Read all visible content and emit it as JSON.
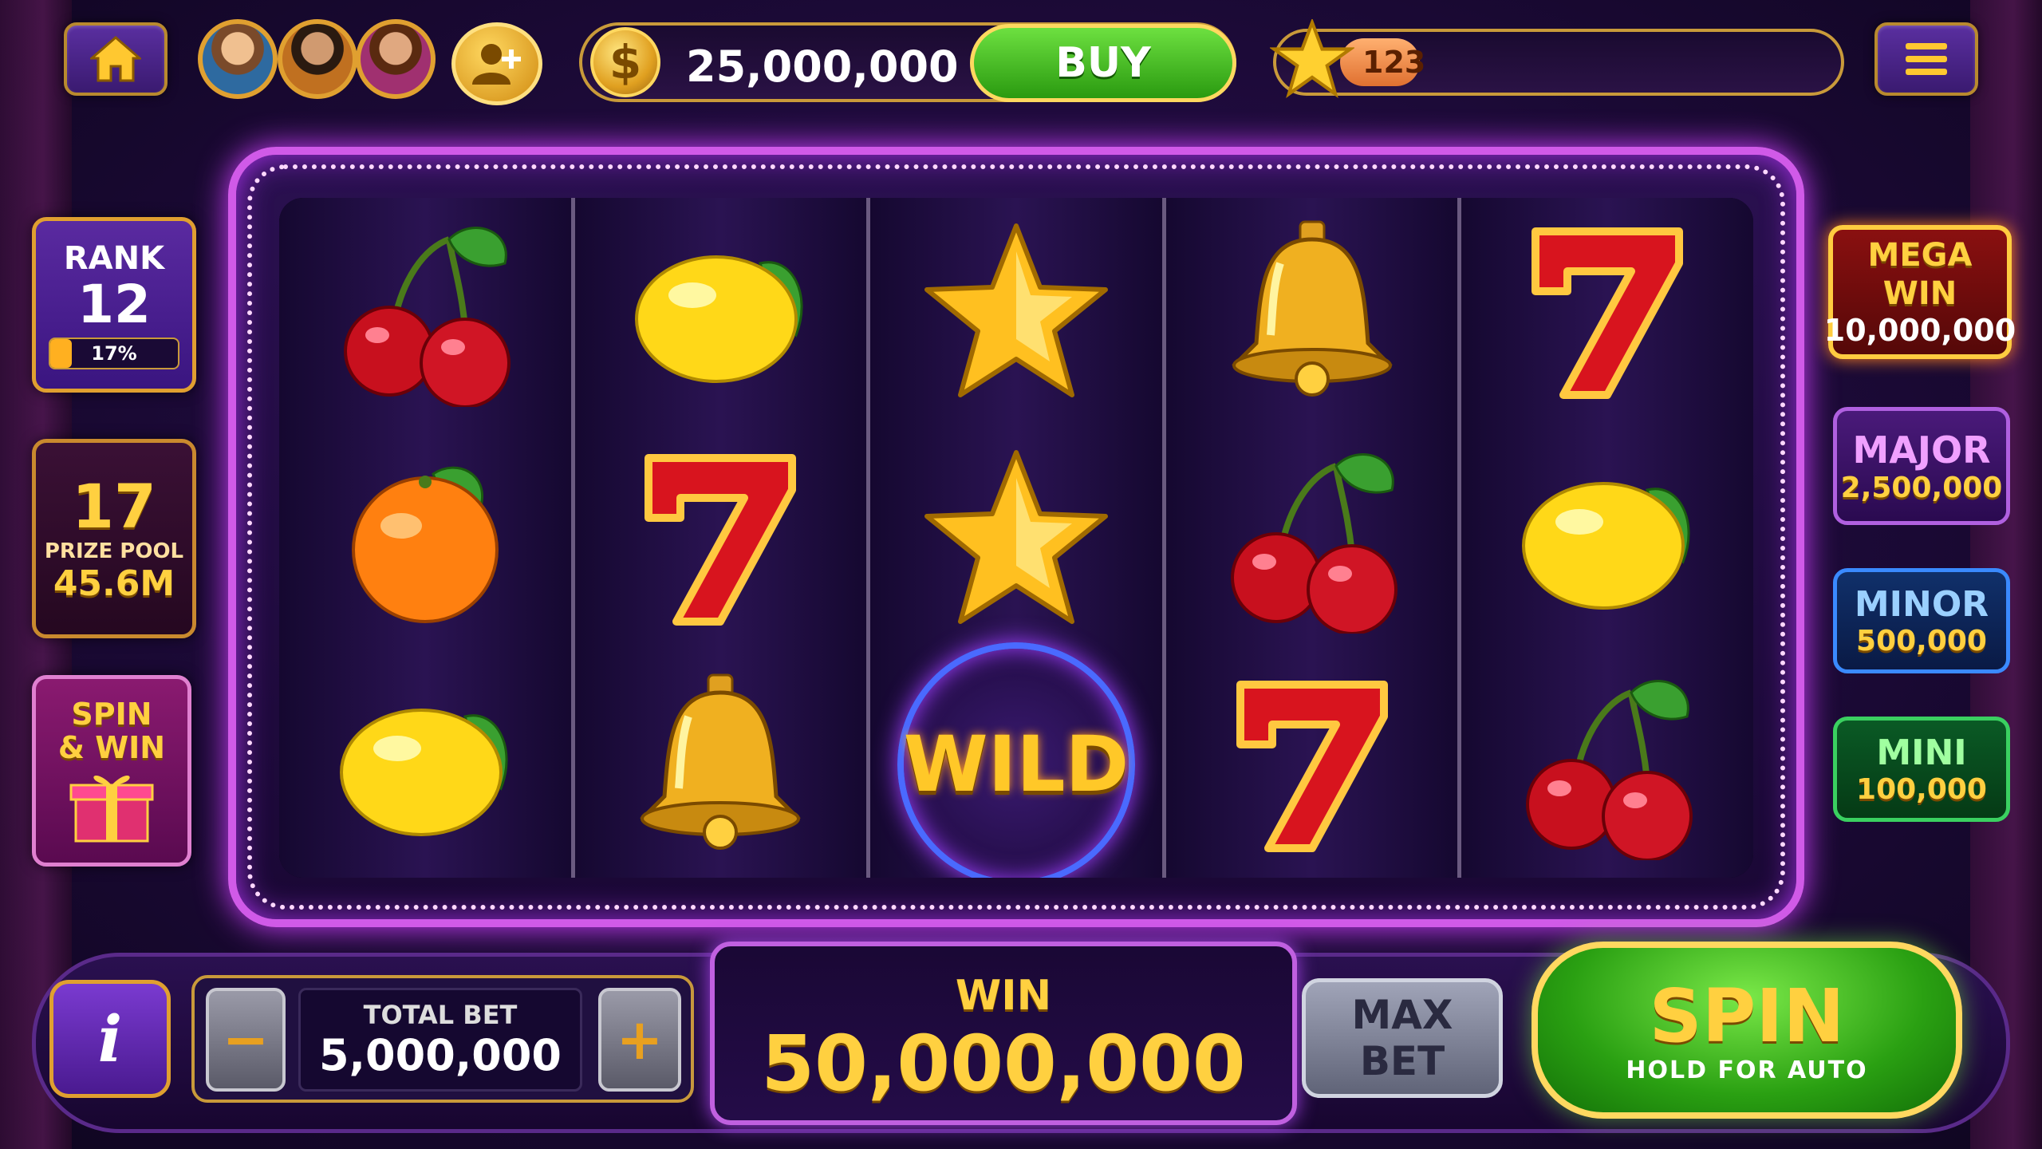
{
  "top_bar": {
    "coins": "25,000,000",
    "buy_label": "BUY",
    "level": "123"
  },
  "rank": {
    "label": "RANK",
    "value": "12",
    "progress_label": "17%",
    "progress": 0.17
  },
  "prize_pool": {
    "value": "17",
    "label": "PRIZE POOL",
    "amount": "45.6M"
  },
  "spin_win": {
    "line1": "SPIN",
    "line2": "& WIN"
  },
  "jackpots": [
    {
      "name": "MEGA WIN",
      "amount": "10,000,000"
    },
    {
      "name": "MAJOR",
      "amount": "2,500,000"
    },
    {
      "name": "MINOR",
      "amount": "500,000"
    },
    {
      "name": "MINI",
      "amount": "100,000"
    }
  ],
  "reels": [
    [
      "cherry",
      "orange",
      "lemon"
    ],
    [
      "lemon",
      "seven",
      "bell"
    ],
    [
      "star",
      "star",
      "wild"
    ],
    [
      "bell",
      "cherry",
      "seven"
    ],
    [
      "seven",
      "lemon",
      "cherry"
    ]
  ],
  "wild_label": "WILD",
  "bottom": {
    "info_label": "i",
    "minus_label": "−",
    "plus_label": "+",
    "total_bet_label": "TOTAL BET",
    "total_bet": "5,000,000",
    "win_label": "WIN",
    "win_amount": "50,000,000",
    "max_bet_line1": "MAX",
    "max_bet_line2": "BET",
    "spin_label": "SPIN",
    "spin_sub": "HOLD FOR AUTO"
  }
}
